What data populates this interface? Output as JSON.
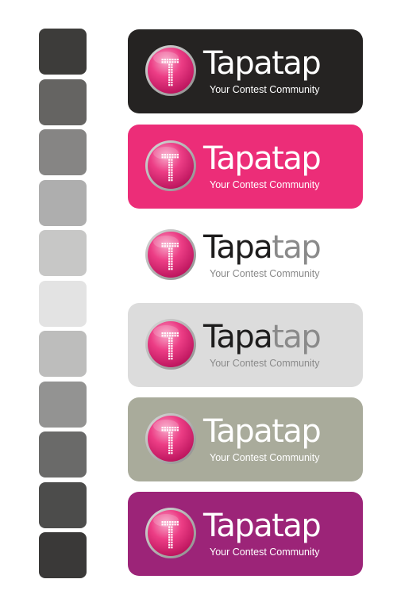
{
  "brand": {
    "name_head": "Tapa",
    "name_tail": "tap",
    "tagline": "Your Contest Community"
  },
  "swatch_colors": [
    "#3d3c3a",
    "#656462",
    "#868584",
    "#aeaeae",
    "#c7c7c6",
    "#e3e3e3",
    "#bdbdbc",
    "#939392",
    "#6a6a69",
    "#4c4c4b",
    "#3a3938"
  ],
  "panels": [
    {
      "background": "#252322",
      "head_color": "#ffffff",
      "tail_color": "#ffffff",
      "tagline_color": "#ffffff"
    },
    {
      "background": "#ec2d78",
      "head_color": "#ffffff",
      "tail_color": "#ffffff",
      "tagline_color": "#ffffff"
    },
    {
      "background": "#ffffff",
      "head_color": "#1d1c1c",
      "tail_color": "#8a8a8a",
      "tagline_color": "#8a8a8a"
    },
    {
      "background": "#dcdcdc",
      "head_color": "#1d1c1c",
      "tail_color": "#8a8a8a",
      "tagline_color": "#8a8a8a"
    },
    {
      "background": "#a9ab9b",
      "head_color": "#ffffff",
      "tail_color": "#ffffff",
      "tagline_color": "#ffffff"
    },
    {
      "background": "#9c2478",
      "head_color": "#ffffff",
      "tail_color": "#ffffff",
      "tagline_color": "#ffffff"
    }
  ],
  "icon_names": {
    "badge": "tapatap-t-badge-icon"
  }
}
